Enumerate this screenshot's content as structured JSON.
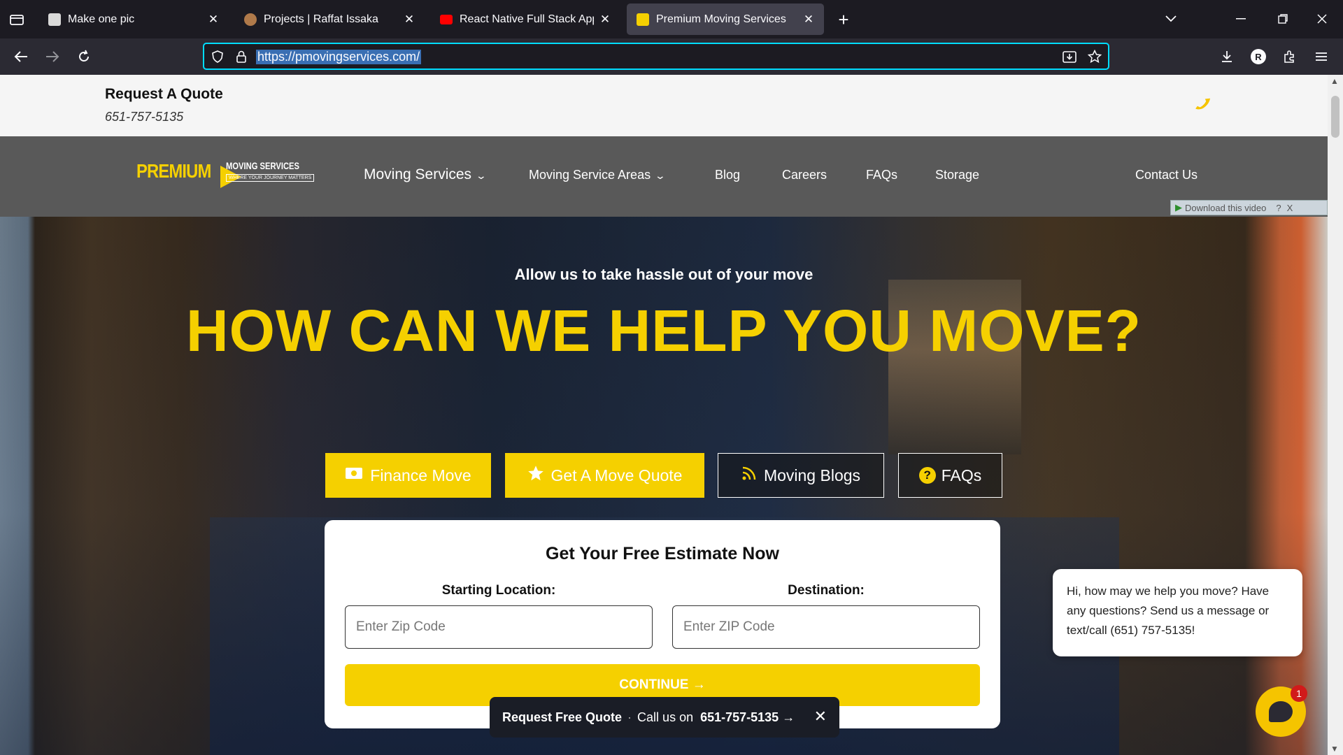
{
  "browser": {
    "tabs": [
      {
        "title": "Make one pic",
        "favicon_color": "#d9d9d9",
        "active": false
      },
      {
        "title": "Projects | Raffat Issaka",
        "favicon_color": "#b07a4a",
        "active": false
      },
      {
        "title": "React Native Full Stack App | Re",
        "favicon_color": "#ff0000",
        "active": false
      },
      {
        "title": "Premium Moving Services",
        "favicon_color": "#f5d000",
        "active": true
      }
    ],
    "tab_close": "✕",
    "new_tab": "+",
    "url": "https://pmovingservices.com/",
    "icons": [
      "tab-list-icon",
      "back-icon",
      "forward-icon",
      "reload-icon",
      "shield-icon",
      "lock-icon",
      "save-page-icon",
      "star-icon",
      "download-icon",
      "profile-icon",
      "extensions-icon",
      "menu-icon"
    ],
    "profile_letter": "R"
  },
  "top_strip": {
    "request_label": "Request A Quote",
    "phone": "651-757-5135"
  },
  "nav": {
    "logo": {
      "brand": "PREMIUM",
      "line1": "MOVING SERVICES",
      "line2": "WHERE YOUR JOURNEY MATTERS"
    },
    "items": [
      {
        "label": "Moving Services",
        "has_dropdown": true
      },
      {
        "label": "Moving Service Areas",
        "has_dropdown": true
      },
      {
        "label": "Blog"
      },
      {
        "label": "Careers"
      },
      {
        "label": "FAQs"
      },
      {
        "label": "Storage"
      },
      {
        "label": "Contact Us"
      }
    ],
    "dropdown_glyph": "⌄"
  },
  "overlay": {
    "download_video": "Download this video",
    "help": "?",
    "close": "X"
  },
  "hero": {
    "subtitle": "Allow us to take hassle out of your move",
    "title": "HOW CAN WE HELP YOU MOVE?",
    "buttons": [
      {
        "label": "Finance Move",
        "icon": "money-icon"
      },
      {
        "label": "Get A Move Quote",
        "icon": "star-icon"
      },
      {
        "label": "Moving Blogs",
        "icon": "rss-icon"
      },
      {
        "label": "FAQs",
        "icon": "question-icon"
      }
    ]
  },
  "estimate": {
    "title": "Get Your Free Estimate Now",
    "start_label": "Starting Location:",
    "start_placeholder": "Enter Zip Code",
    "dest_label": "Destination:",
    "dest_placeholder": "Enter ZIP Code",
    "continue": "CONTINUE →"
  },
  "chat": {
    "message": "Hi, how may we help you move? Have any questions? Send us a message or text/call (651) 757-5135!",
    "badge": "1"
  },
  "quote_bar": {
    "label": "Request Free Quote",
    "separator": "·",
    "call_text": "Call us on",
    "phone": "651-757-5135 →",
    "close": "✕"
  },
  "colors": {
    "brand_yellow": "#f5d000",
    "nav_gray": "#595959",
    "url_focus": "#00ddff"
  }
}
